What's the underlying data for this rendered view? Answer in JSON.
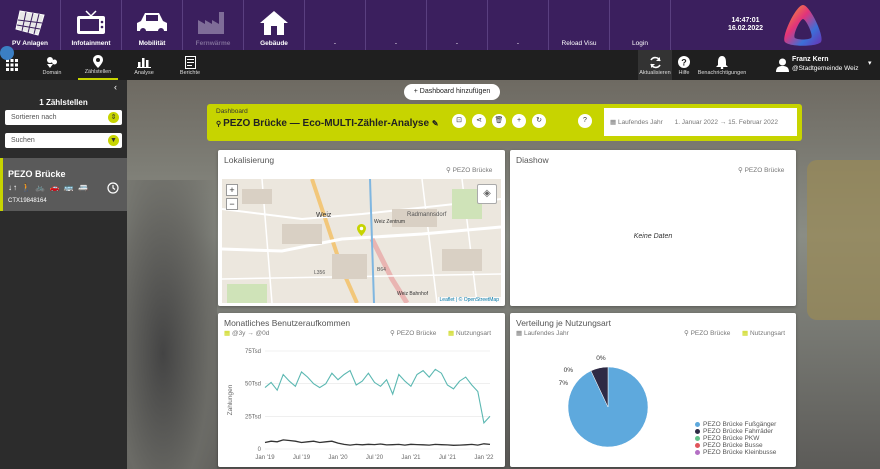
{
  "apps": [
    {
      "label": "PV Anlagen",
      "icon": "solar-panel-icon",
      "state": "normal"
    },
    {
      "label": "Infotainment",
      "icon": "tv-icon",
      "state": "normal"
    },
    {
      "label": "Mobilität",
      "icon": "car-icon",
      "state": "normal"
    },
    {
      "label": "Fernwärme",
      "icon": "factory-icon",
      "state": "disabled"
    },
    {
      "label": "Gebäude",
      "icon": "house-icon",
      "state": "normal"
    },
    {
      "label": "-",
      "icon": "",
      "state": "empty"
    },
    {
      "label": "-",
      "icon": "",
      "state": "empty"
    },
    {
      "label": "-",
      "icon": "",
      "state": "empty"
    },
    {
      "label": "-",
      "icon": "",
      "state": "empty"
    },
    {
      "label": "Reload Visu",
      "icon": "",
      "state": "empty"
    },
    {
      "label": "Login",
      "icon": "",
      "state": "empty"
    }
  ],
  "clock": {
    "time": "14:47:01",
    "date": "16.02.2022"
  },
  "nav": {
    "tabs": [
      {
        "label": "Domain",
        "icon": "domain-icon"
      },
      {
        "label": "Zählstellen",
        "icon": "location-pin-icon"
      },
      {
        "label": "Analyse",
        "icon": "bar-chart-icon"
      },
      {
        "label": "Berichte",
        "icon": "report-icon"
      }
    ],
    "right": [
      {
        "label": "Aktualisieren",
        "icon": "refresh-icon"
      },
      {
        "label": "Hilfe",
        "icon": "help-icon"
      },
      {
        "label": "Benachrichtigungen",
        "icon": "bell-icon"
      }
    ]
  },
  "user": {
    "name": "Franz Kern",
    "org": "@Stadtgemeinde Weiz"
  },
  "sidebar": {
    "count_label": "1 Zählstellen",
    "sort_placeholder": "Sortieren nach",
    "search_placeholder": "Suchen",
    "station": {
      "name": "PEZO Brücke",
      "modes": "↓↑ 🚶 🚲 🚗 🚌 🚐",
      "id": "CTX19848164"
    }
  },
  "main": {
    "add_button": "+ Dashboard hinzufügen",
    "dashboard_label": "Dashboard",
    "dashboard_title": "PEZO Brücke — Eco-MULTI-Zähler-Analyse",
    "range_label": "Laufendes Jahr",
    "range_from": "1. Januar 2022",
    "range_sep": "→",
    "range_to": "15. Februar 2022"
  },
  "cards": {
    "map": {
      "title": "Lokalisierung",
      "location": "PEZO Brücke",
      "attribution": "Leaflet | © OpenStreetMap",
      "labels": {
        "weiz": "Weiz",
        "zentrum": "Weiz Zentrum",
        "radmannsdorf": "Radmannsdorf",
        "bahnhof": "Weiz Bahnhof",
        "l356": "L356",
        "b64": "B64"
      }
    },
    "slideshow": {
      "title": "Diashow",
      "location": "PEZO Brücke",
      "empty": "Keine Daten"
    },
    "monthly": {
      "title": "Monatliches Benutzeraufkommen",
      "period": "@3y → @0d",
      "location": "PEZO Brücke",
      "type": "Nutzungsart"
    },
    "usage": {
      "title": "Verteilung je Nutzungsart",
      "period": "Laufendes Jahr",
      "location": "PEZO Brücke",
      "type": "Nutzungsart"
    }
  },
  "colors": {
    "accent": "#c7d400",
    "topbar": "#3b1f5e",
    "line_main": "#5cb8b2",
    "line_second": "#333333"
  },
  "chart_data": [
    {
      "type": "line",
      "ylabel": "Zahlungen",
      "ylim": [
        0,
        75000
      ],
      "yticks": [
        "75Tsd",
        "50Tsd",
        "25Tsd",
        "0"
      ],
      "ytick_values": [
        75000,
        50000,
        25000,
        0
      ],
      "xticks": [
        "Jan '19",
        "Jul '19",
        "Jan '20",
        "Jul '20",
        "Jan '21",
        "Jul '21",
        "Jan '22"
      ],
      "xtick_months": [
        0,
        6,
        12,
        18,
        24,
        30,
        36
      ],
      "series": [
        {
          "values": [
            47000,
            51000,
            45000,
            57000,
            52000,
            48000,
            59000,
            55000,
            50000,
            47000,
            50000,
            58000,
            53000,
            57000,
            60000,
            49000,
            52000,
            58000,
            51000,
            48000,
            53000,
            42000,
            57000,
            52000,
            48000,
            57000,
            60000,
            55000,
            61000,
            58000,
            49000,
            46000,
            52000,
            55000,
            49000,
            44000,
            20000,
            25000
          ]
        },
        {
          "values": [
            5000,
            6000,
            5500,
            7000,
            6500,
            6000,
            5000,
            5500,
            6000,
            5000,
            5500,
            6000,
            4500,
            3500,
            3000,
            3500,
            3200,
            3600,
            3400,
            3800,
            3100,
            3300,
            3500,
            3000,
            3600,
            3400,
            3200,
            3000,
            3500,
            3300,
            3100,
            2800,
            3000,
            3200,
            3500,
            3000,
            4000,
            3500
          ]
        }
      ]
    },
    {
      "type": "pie",
      "categories": [
        "PEZO Brücke Fußgänger",
        "PEZO Brücke Fahrräder",
        "PEZO Brücke PKW",
        "PEZO Brücke Busse",
        "PEZO Brücke Kleinbusse"
      ],
      "values": [
        93,
        7,
        0,
        0,
        0
      ],
      "slice_labels": [
        "93%",
        "7%",
        "0%",
        "0%",
        "0%"
      ],
      "colors": [
        "#5ea9dd",
        "#2e2a45",
        "#62c28a",
        "#e0565b",
        "#b46fc4"
      ]
    }
  ]
}
